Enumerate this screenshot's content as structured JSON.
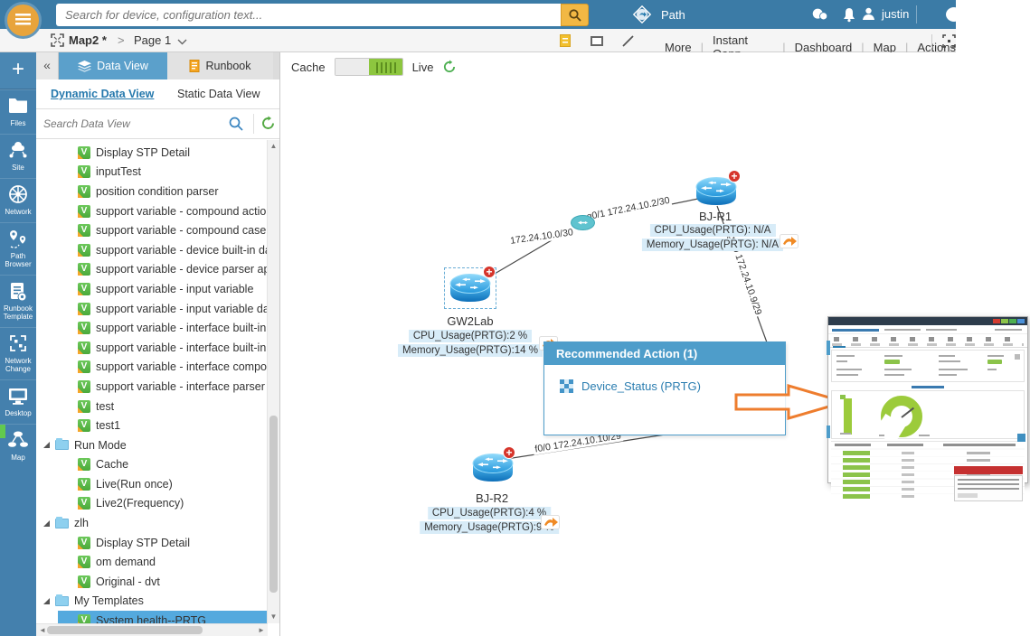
{
  "topbar": {
    "search_placeholder": "Search for device, configuration text...",
    "path_label": "Path",
    "username": "justin"
  },
  "toolbar": {
    "map_title": "Map2 *",
    "crumb_separator": ">",
    "page_label": "Page 1",
    "menu_items": [
      "More",
      "Instant Qapp",
      "Dashboard",
      "Map",
      "Actions"
    ]
  },
  "left_nav": {
    "items": [
      {
        "name": "add",
        "icon": "plus-icon",
        "label": ""
      },
      {
        "name": "files",
        "icon": "files-folder-icon",
        "label": "Files"
      },
      {
        "name": "site",
        "icon": "site-icon",
        "label": "Site"
      },
      {
        "name": "network",
        "icon": "network-globe-icon",
        "label": "Network"
      },
      {
        "name": "path-browser",
        "icon": "path-browser-icon",
        "label": "Path\nBrowser"
      },
      {
        "name": "runbook-template",
        "icon": "runbook-template-icon",
        "label": "Runbook\nTemplate"
      },
      {
        "name": "network-change",
        "icon": "network-change-icon",
        "label": "Network\nChange"
      },
      {
        "name": "desktop",
        "icon": "desktop-monitor-icon",
        "label": "Desktop"
      },
      {
        "name": "map",
        "icon": "map-sitemap-icon",
        "label": "Map",
        "active": true
      }
    ]
  },
  "panel": {
    "collapse_glyph": "«",
    "tabs": [
      {
        "label": "Data View",
        "active": true
      },
      {
        "label": "Runbook",
        "active": false
      }
    ],
    "subtabs": [
      "Dynamic Data View",
      "Static Data View"
    ],
    "search_placeholder": "Search Data View",
    "tree": [
      {
        "type": "item",
        "label": "Display STP Detail"
      },
      {
        "type": "item",
        "label": "inputTest"
      },
      {
        "type": "item",
        "label": "position condition parser"
      },
      {
        "type": "item",
        "label": "support variable - compound action"
      },
      {
        "type": "item",
        "label": "support variable - compound case"
      },
      {
        "type": "item",
        "label": "support variable - device built-in data"
      },
      {
        "type": "item",
        "label": "support variable - device parser api"
      },
      {
        "type": "item",
        "label": "support variable - input variable"
      },
      {
        "type": "item",
        "label": "support variable - input variable data t"
      },
      {
        "type": "item",
        "label": "support variable - interface built-in dat"
      },
      {
        "type": "item",
        "label": "support variable - interface built-in ref"
      },
      {
        "type": "item",
        "label": "support variable - interface compound"
      },
      {
        "type": "item",
        "label": "support variable - interface parser"
      },
      {
        "type": "item",
        "label": "test"
      },
      {
        "type": "item",
        "label": "test1"
      },
      {
        "type": "folder",
        "label": "Run Mode"
      },
      {
        "type": "child",
        "label": "Cache"
      },
      {
        "type": "child",
        "label": "Live(Run once)"
      },
      {
        "type": "child",
        "label": "Live2(Frequency)"
      },
      {
        "type": "folder",
        "label": "zlh"
      },
      {
        "type": "child",
        "label": "Display STP Detail"
      },
      {
        "type": "child",
        "label": "om demand"
      },
      {
        "type": "child",
        "label": "Original - dvt"
      },
      {
        "type": "folder",
        "label": "My Templates"
      },
      {
        "type": "child",
        "label": "System health--PRTG",
        "selected": true
      }
    ],
    "scroll_glyphs": {
      "up": "▲",
      "down": "▼",
      "left": "◄",
      "right": "►"
    }
  },
  "canvas": {
    "mode_toggle": {
      "cache_label": "Cache",
      "live_label": "Live"
    },
    "devices": [
      {
        "name": "GW2Lab",
        "cpu_label": "CPU_Usage(PRTG):2 %",
        "memory_label": "Memory_Usage(PRTG):14 %"
      },
      {
        "name": "BJ-R1",
        "cpu_label": "CPU_Usage(PRTG): N/A",
        "memory_label": "Memory_Usage(PRTG): N/A"
      },
      {
        "name": "BJ-R2",
        "cpu_label": "CPU_Usage(PRTG):4 %",
        "memory_label": "Memory_Usage(PRTG):9 %"
      }
    ],
    "link_labels": {
      "gw2lab_bjr1_interface": "g0/1 172.24.10.2/30",
      "gw2lab_bjr1_subnet": "172.24.10.0/30",
      "bjr1_bjr2_interface_top": "g0/0 172.24.10.9/29",
      "bjr1_bjr2_interface_bottom": "f0/0 172.24.10.10/29"
    },
    "popup": {
      "title": "Recommended Action (1)",
      "action_label": "Device_Status (PRTG)"
    }
  },
  "colors": {
    "topbar_blue": "#3b7ba6",
    "rail_blue": "#4480ad",
    "accent_orange": "#e8a43c",
    "live_green": "#8dc63f",
    "selection_blue": "#54a9de",
    "popup_blue": "#4e9dca",
    "chip_blue": "#d8ecf8",
    "annotation_orange": "#ee7d2e",
    "gauge_green": "#9ccb3b",
    "alert_red": "#c53030"
  }
}
